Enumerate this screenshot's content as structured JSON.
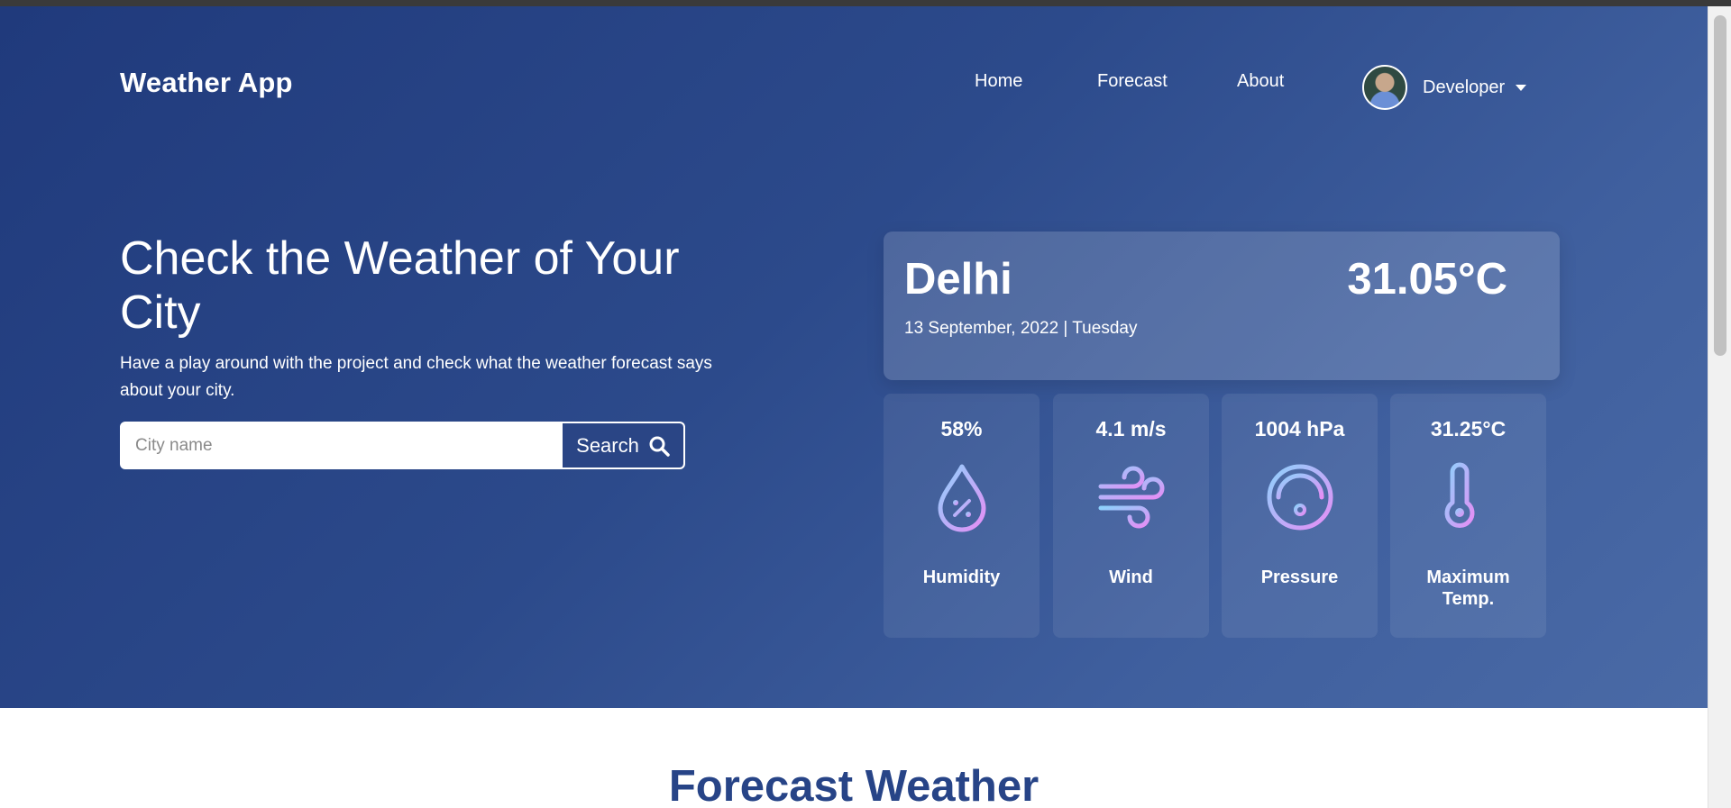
{
  "nav": {
    "brand": "Weather App",
    "links": [
      "Home",
      "Forecast",
      "About"
    ],
    "user": "Developer"
  },
  "hero": {
    "title": "Check the Weather of Your City",
    "subtitle": "Have a play around with the project and check what the weather forecast says about your city.",
    "search_placeholder": "City name",
    "search_button": "Search"
  },
  "current": {
    "city": "Delhi",
    "temperature": "31.05°C",
    "date": "13 September, 2022 | Tuesday"
  },
  "stats": [
    {
      "value": "58%",
      "label": "Humidity",
      "icon": "humidity-drop-icon"
    },
    {
      "value": "4.1 m/s",
      "label": "Wind",
      "icon": "wind-icon"
    },
    {
      "value": "1004 hPa",
      "label": "Pressure",
      "icon": "pressure-gauge-icon"
    },
    {
      "value": "31.25°C",
      "label": "Maximum Temp.",
      "icon": "thermometer-icon"
    }
  ],
  "forecast": {
    "title": "Forecast Weather"
  },
  "colors": {
    "hero_start": "#203a7c",
    "hero_end": "#4a6aa6",
    "accent": "#274487",
    "icon_gradient_start": "#8ed1fc",
    "icon_gradient_end": "#e58ef5"
  }
}
